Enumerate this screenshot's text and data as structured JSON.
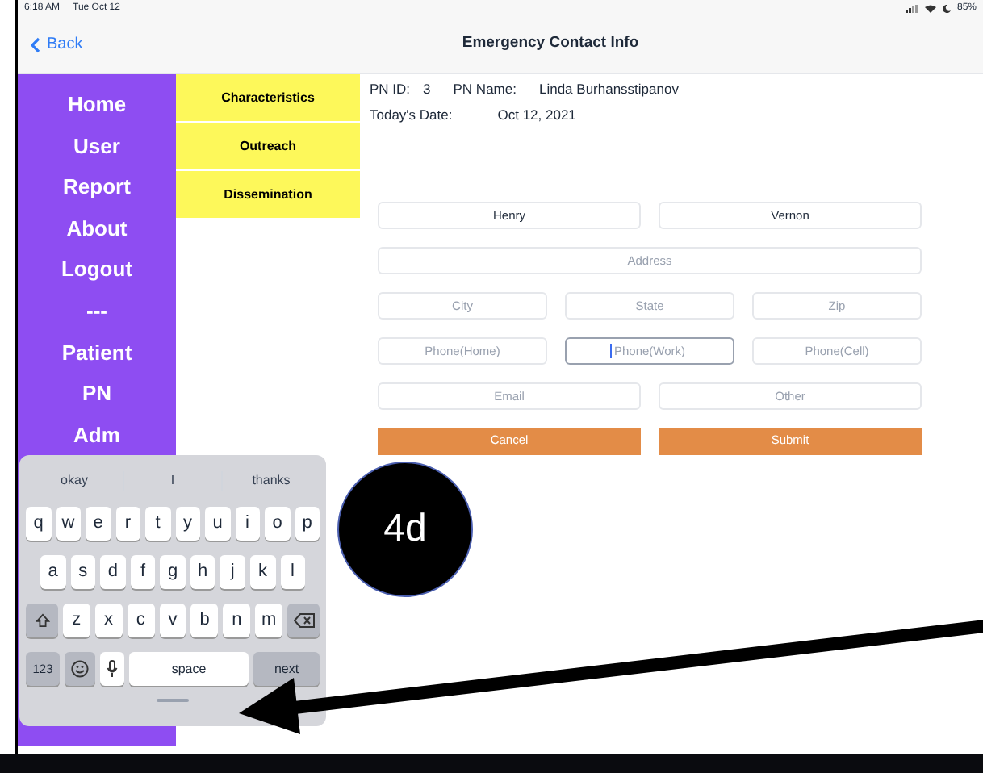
{
  "status_bar": {
    "time": "6:18 AM",
    "date": "Tue Oct 12",
    "battery": "85%"
  },
  "nav": {
    "back": "Back",
    "title": "Emergency Contact Info"
  },
  "sidebar": {
    "items": [
      {
        "label": "Home"
      },
      {
        "label": "User"
      },
      {
        "label": "Report"
      },
      {
        "label": "About"
      },
      {
        "label": "Logout"
      },
      {
        "label": "---"
      },
      {
        "label": "Patient"
      },
      {
        "label": "PN"
      },
      {
        "label": "Adm"
      }
    ]
  },
  "sections": [
    {
      "label": "Characteristics"
    },
    {
      "label": "Outreach"
    },
    {
      "label": "Dissemination"
    }
  ],
  "info": {
    "pn_id_label": "PN ID:",
    "pn_id": "3",
    "pn_name_label": "PN Name:",
    "pn_name": "Linda Burhansstipanov",
    "date_label": "Today's Date:",
    "date": "Oct 12, 2021"
  },
  "form": {
    "rows": [
      [
        {
          "value": "Henry",
          "focused": false
        },
        {
          "value": "Vernon",
          "focused": false
        }
      ],
      [
        {
          "placeholder": "Address",
          "focused": false
        }
      ],
      [
        {
          "placeholder": "City",
          "focused": false
        },
        {
          "placeholder": "State",
          "focused": false
        },
        {
          "placeholder": "Zip",
          "focused": false
        }
      ],
      [
        {
          "placeholder": "Phone(Home)",
          "focused": false
        },
        {
          "placeholder": "Phone(Work)",
          "focused": true
        },
        {
          "placeholder": "Phone(Cell)",
          "focused": false
        }
      ],
      [
        {
          "placeholder": "Email",
          "focused": false
        },
        {
          "placeholder": "Other",
          "focused": false
        }
      ]
    ],
    "buttons": [
      "Cancel",
      "Submit"
    ]
  },
  "keyboard": {
    "suggestions": [
      "okay",
      "I",
      "thanks"
    ],
    "rows": [
      {
        "keys": [
          {
            "kind": "letter",
            "label": "q"
          },
          {
            "kind": "letter",
            "label": "w"
          },
          {
            "kind": "letter",
            "label": "e"
          },
          {
            "kind": "letter",
            "label": "r"
          },
          {
            "kind": "letter",
            "label": "t"
          },
          {
            "kind": "letter",
            "label": "y"
          },
          {
            "kind": "letter",
            "label": "u"
          },
          {
            "kind": "letter",
            "label": "i"
          },
          {
            "kind": "letter",
            "label": "o"
          },
          {
            "kind": "letter",
            "label": "p"
          }
        ]
      },
      {
        "keys": [
          {
            "kind": "letter",
            "label": "a"
          },
          {
            "kind": "letter",
            "label": "s"
          },
          {
            "kind": "letter",
            "label": "d"
          },
          {
            "kind": "letter",
            "label": "f"
          },
          {
            "kind": "letter",
            "label": "g"
          },
          {
            "kind": "letter",
            "label": "h"
          },
          {
            "kind": "letter",
            "label": "j"
          },
          {
            "kind": "letter",
            "label": "k"
          },
          {
            "kind": "letter",
            "label": "l"
          }
        ]
      },
      {
        "keys": [
          {
            "kind": "shift"
          },
          {
            "kind": "letter",
            "label": "z"
          },
          {
            "kind": "letter",
            "label": "x"
          },
          {
            "kind": "letter",
            "label": "c"
          },
          {
            "kind": "letter",
            "label": "v"
          },
          {
            "kind": "letter",
            "label": "b"
          },
          {
            "kind": "letter",
            "label": "n"
          },
          {
            "kind": "letter",
            "label": "m"
          },
          {
            "kind": "backspace"
          }
        ]
      }
    ],
    "bottom_row": [
      {
        "kind": "mode",
        "label": "123"
      },
      {
        "kind": "emoji"
      },
      {
        "kind": "mic"
      },
      {
        "kind": "space",
        "label": "space"
      },
      {
        "kind": "return",
        "label": "next"
      }
    ]
  },
  "annotation": {
    "label": "4d"
  }
}
